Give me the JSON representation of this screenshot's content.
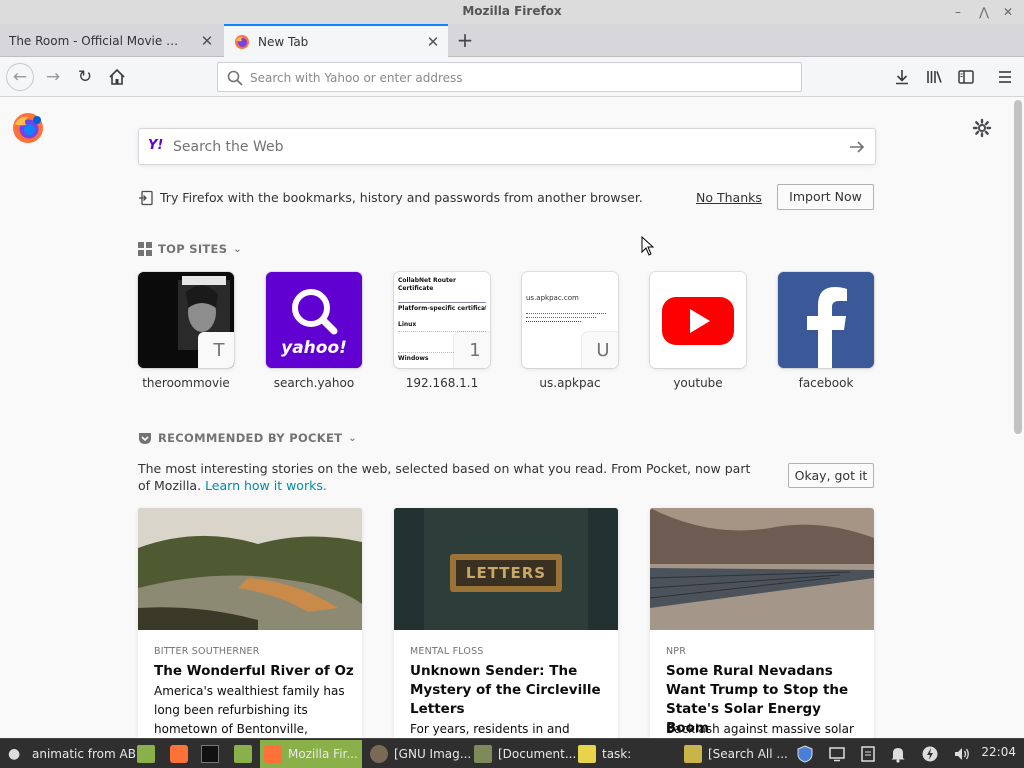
{
  "window": {
    "title": "Mozilla Firefox"
  },
  "tabs": [
    {
      "label": "The Room - Official Movie Site, Vie",
      "active": false
    },
    {
      "label": "New Tab",
      "active": true
    }
  ],
  "urlbar": {
    "placeholder": "Search with Yahoo or enter address"
  },
  "search": {
    "placeholder": "Search the Web",
    "engine_logo": "Y!"
  },
  "migration": {
    "text": "Try Firefox with the bookmarks, history and passwords from another browser.",
    "no_thanks": "No Thanks",
    "import_now": "Import Now"
  },
  "top_sites": {
    "title": "TOP SITES",
    "sites": [
      {
        "name": "theroommovie",
        "letter": "T"
      },
      {
        "name": "search.yahoo",
        "logo_text": "yahoo!"
      },
      {
        "name": "192.168.1.1",
        "letter": "1",
        "preview_lines": [
          "CollabNet Router",
          "Certificate",
          "Platform-specific certificate install",
          "Linux",
          "Windows"
        ]
      },
      {
        "name": "us.apkpac",
        "letter": "U",
        "preview_lines": [
          "us.apkpac.com"
        ]
      },
      {
        "name": "youtube"
      },
      {
        "name": "facebook"
      }
    ]
  },
  "pocket": {
    "title": "RECOMMENDED BY POCKET",
    "description": "The most interesting stories on the web, selected based on what you read. From Pocket, now part of Mozilla.",
    "learn_more": "Learn how it works.",
    "okay": "Okay, got it",
    "cards": [
      {
        "source": "BITTER SOUTHERNER",
        "title": "The Wonderful River of Oz",
        "excerpt": "America's wealthiest family has long been refurbishing its hometown of Bentonville,"
      },
      {
        "source": "MENTAL FLOSS",
        "title": "Unknown Sender: The Mystery of the Circleville Letters",
        "excerpt": "For years, residents in and around",
        "image_text": "LETTERS"
      },
      {
        "source": "NPR",
        "title": "Some Rural Nevadans Want Trump to Stop the State's Solar Energy Boom",
        "excerpt": "Backlash against massive solar"
      }
    ]
  },
  "taskbar": {
    "items": [
      {
        "label": "animatic from AB"
      },
      {
        "label": "Mozilla Fir...",
        "active": true
      },
      {
        "label": "[GNU Imag..."
      },
      {
        "label": "[Document..."
      },
      {
        "label": "task:"
      },
      {
        "label": "[Search All ..."
      }
    ],
    "clock": "22:04"
  },
  "colors": {
    "accent": "#0a84ff",
    "pocket_link": "#008ea4",
    "yahoo": "#6001d2",
    "youtube": "#ff0000",
    "facebook": "#3b5998"
  }
}
